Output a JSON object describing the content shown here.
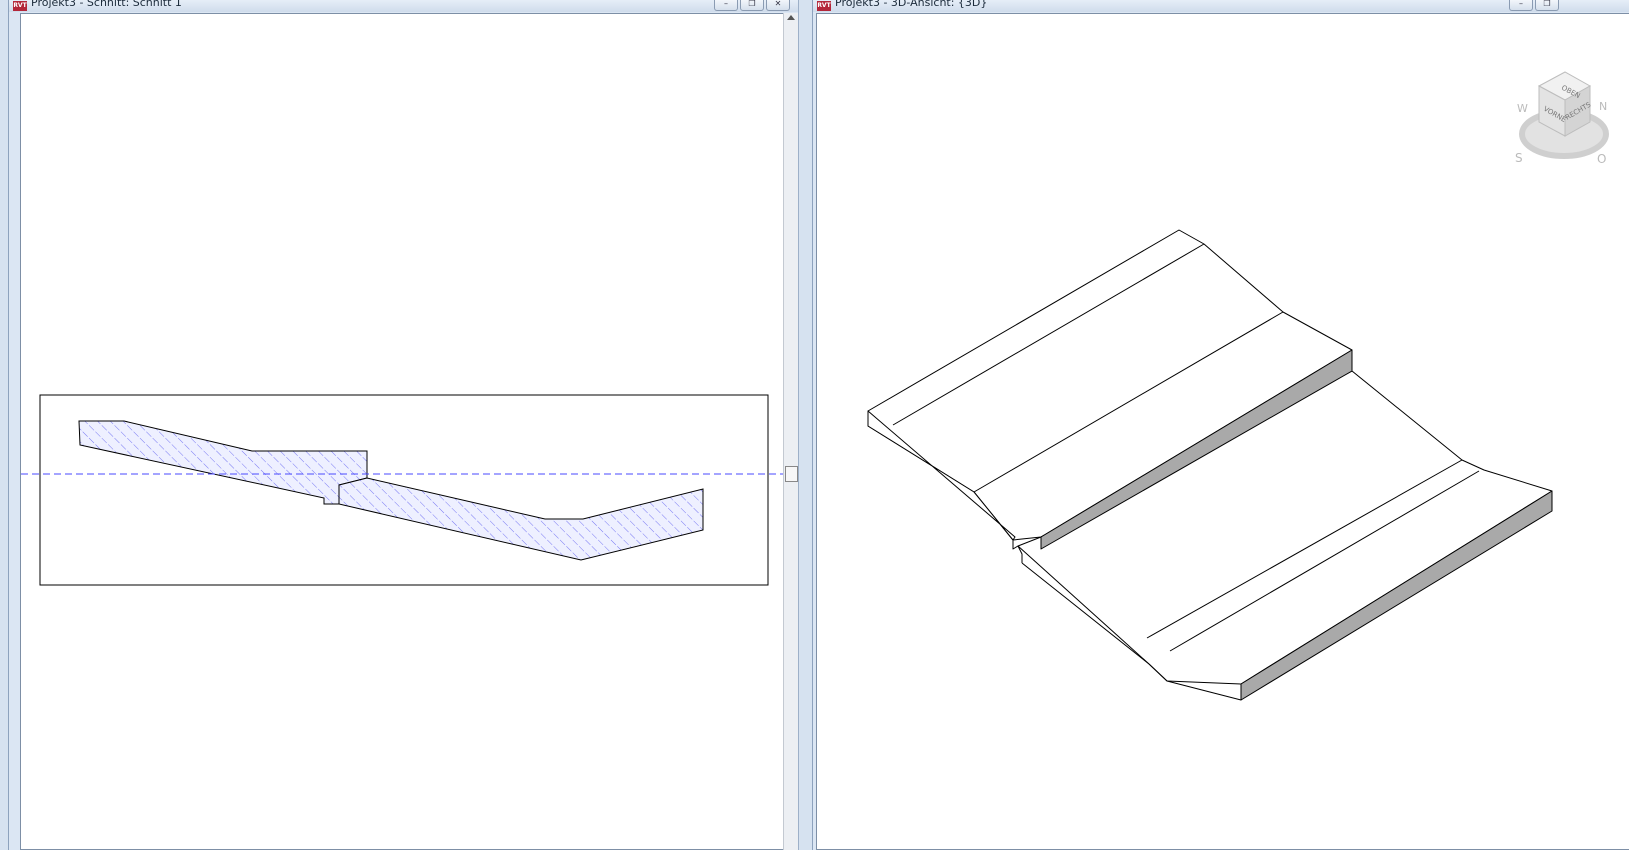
{
  "left_window": {
    "app_badge": "RVT",
    "title": "Projekt3 - Schnitt: Schnitt 1",
    "controls": {
      "minimize": "–",
      "restore": "❐",
      "close": "✕"
    }
  },
  "right_window": {
    "app_badge": "RVT",
    "title": "Projekt3 - 3D-Ansicht: {3D}",
    "controls": {
      "minimize": "–",
      "restore": "❐"
    }
  },
  "viewcube": {
    "top": "OBEN",
    "front": "VORNE",
    "right": "RECHTS",
    "compass_n": "N",
    "compass_s": "S",
    "compass_w": "W",
    "compass_o": "O"
  },
  "colors": {
    "section_line": "#4a4aff",
    "hatch": "#5a5af0",
    "titlebar": "#dbe6f3"
  },
  "icons": [
    "revit-app-icon",
    "minimize-icon",
    "restore-icon",
    "close-icon",
    "scroll-up-arrow-icon",
    "viewcube-icon"
  ]
}
